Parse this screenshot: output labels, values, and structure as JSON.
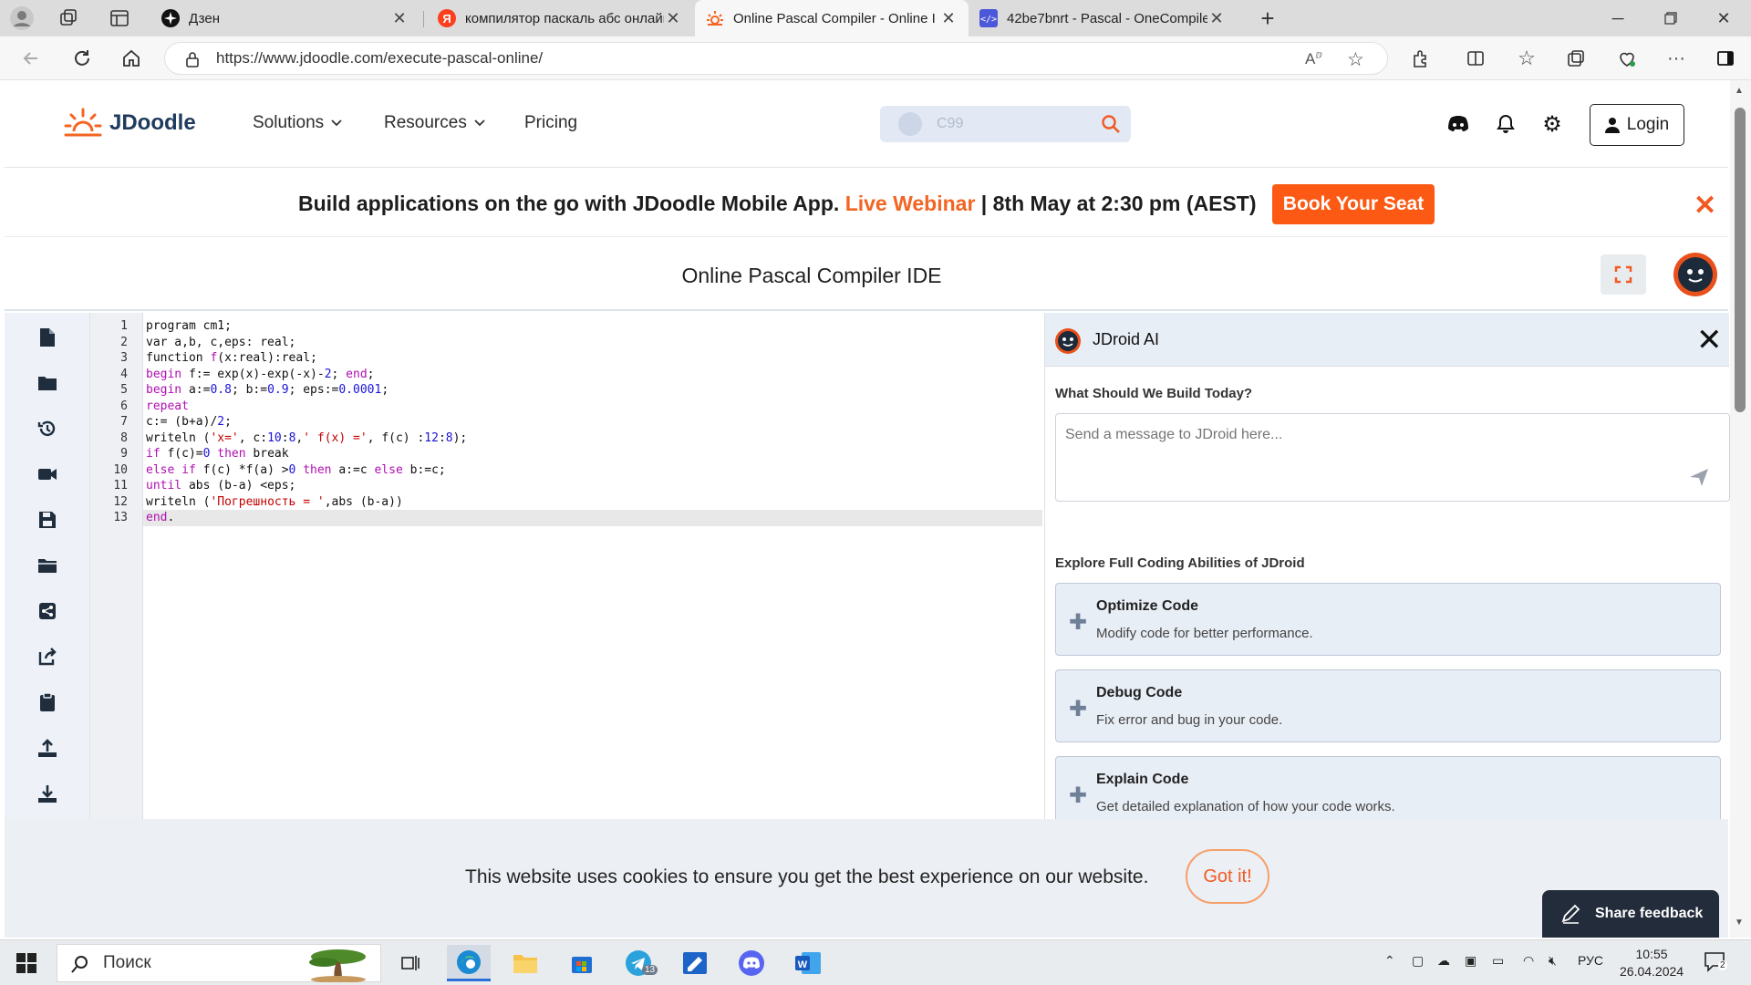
{
  "browser": {
    "tabs": [
      {
        "title": "Дзен",
        "active": false
      },
      {
        "title": "компилятор паскаль абс онлайн",
        "active": false
      },
      {
        "title": "Online Pascal Compiler - Online I",
        "active": true
      },
      {
        "title": "42be7bnrt - Pascal - OneCompiler",
        "active": false
      }
    ],
    "url": "https://www.jdoodle.com/execute-pascal-online/"
  },
  "site": {
    "logo_text": "JDoodle",
    "menu": {
      "solutions": "Solutions",
      "resources": "Resources",
      "pricing": "Pricing"
    },
    "search_placeholder": "C99",
    "login_label": "Login"
  },
  "banner": {
    "text_before": "Build applications on the go with JDoodle Mobile App. ",
    "highlight": "Live Webinar",
    "text_after": " | 8th May at 2:30 pm (AEST)",
    "button": "Book Your Seat",
    "close": "✕"
  },
  "ide": {
    "title": "Online Pascal Compiler IDE",
    "current_line": 13,
    "code_lines": [
      [
        [
          "t",
          "program cm1;"
        ]
      ],
      [
        [
          "t",
          "var a,b, c,eps: real;"
        ]
      ],
      [
        [
          "t",
          "function "
        ],
        [
          "k",
          "f"
        ],
        [
          "t",
          "(x:real):real;"
        ]
      ],
      [
        [
          "k",
          "begin"
        ],
        [
          "t",
          " f:= exp(x)-exp(-x)-"
        ],
        [
          "n",
          "2"
        ],
        [
          "t",
          "; "
        ],
        [
          "k",
          "end"
        ],
        [
          "t",
          ";"
        ]
      ],
      [
        [
          "k",
          "begin"
        ],
        [
          "t",
          " a:="
        ],
        [
          "n",
          "0.8"
        ],
        [
          "t",
          "; b:="
        ],
        [
          "n",
          "0.9"
        ],
        [
          "t",
          "; eps:="
        ],
        [
          "n",
          "0.0001"
        ],
        [
          "t",
          ";"
        ]
      ],
      [
        [
          "k",
          "repeat"
        ]
      ],
      [
        [
          "t",
          "c:= (b+a)/"
        ],
        [
          "n",
          "2"
        ],
        [
          "t",
          ";"
        ]
      ],
      [
        [
          "t",
          "writeln ("
        ],
        [
          "s",
          "'x='"
        ],
        [
          "t",
          ", c:"
        ],
        [
          "n",
          "10"
        ],
        [
          "t",
          ":"
        ],
        [
          "n",
          "8"
        ],
        [
          "t",
          ","
        ],
        [
          "s",
          "' f(x) ='"
        ],
        [
          "t",
          ", f(c) :"
        ],
        [
          "n",
          "12"
        ],
        [
          "t",
          ":"
        ],
        [
          "n",
          "8"
        ],
        [
          "t",
          ");"
        ]
      ],
      [
        [
          "k",
          "if"
        ],
        [
          "t",
          " f(c)="
        ],
        [
          "n",
          "0"
        ],
        [
          "t",
          " "
        ],
        [
          "k",
          "then"
        ],
        [
          "t",
          " break"
        ]
      ],
      [
        [
          "k",
          "else"
        ],
        [
          "t",
          " "
        ],
        [
          "k",
          "if"
        ],
        [
          "t",
          " f(c) *f(a) >"
        ],
        [
          "n",
          "0"
        ],
        [
          "t",
          " "
        ],
        [
          "k",
          "then"
        ],
        [
          "t",
          " a:=c "
        ],
        [
          "k",
          "else"
        ],
        [
          "t",
          " b:=c;"
        ]
      ],
      [
        [
          "k",
          "until"
        ],
        [
          "t",
          " abs (b-a) <eps;"
        ]
      ],
      [
        [
          "t",
          "writeln ("
        ],
        [
          "s",
          "'Погрешность = '"
        ],
        [
          "t",
          ",abs (b-a))"
        ]
      ],
      [
        [
          "k",
          "end"
        ],
        [
          "t",
          "."
        ]
      ]
    ]
  },
  "jdroid": {
    "title": "JDroid AI",
    "question": "What Should We Build Today?",
    "input_placeholder": "Send a message to JDroid here...",
    "explore": "Explore Full Coding Abilities of JDroid",
    "cards": [
      {
        "title": "Optimize Code",
        "desc": "Modify code for better performance."
      },
      {
        "title": "Debug Code",
        "desc": "Fix error and bug in your code."
      },
      {
        "title": "Explain Code",
        "desc": "Get detailed explanation of how your code works."
      }
    ]
  },
  "cookie": {
    "text": "This website uses cookies to ensure you get the best experience on our website.",
    "button": "Got it!"
  },
  "feedback": {
    "label": "Share feedback"
  },
  "taskbar": {
    "search_label": "Поиск",
    "telegram_badge": "13",
    "language": "РУС",
    "time": "10:55",
    "date": "26.04.2024",
    "notifications": "2"
  },
  "colors": {
    "brand_orange": "#fc5a14",
    "keyword": "#b00fb0",
    "number": "#1a14d6",
    "string": "#c40000"
  }
}
